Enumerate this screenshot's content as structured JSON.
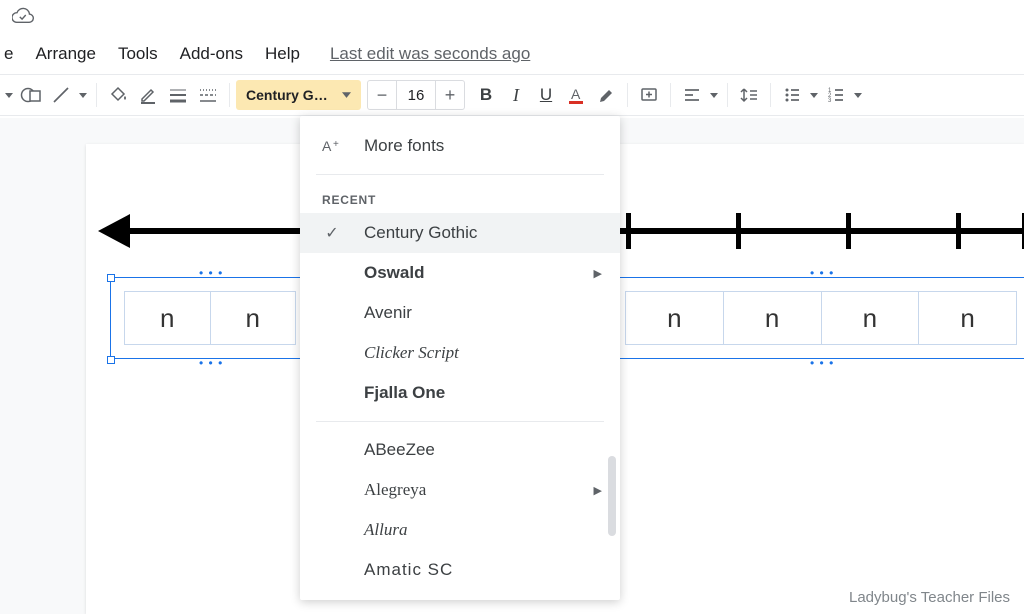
{
  "menubar": {
    "items": [
      "e",
      "Arrange",
      "Tools",
      "Add-ons",
      "Help"
    ],
    "edit_status": "Last edit was seconds ago"
  },
  "toolbar": {
    "font_selector_label": "Century Go…",
    "font_size": "16"
  },
  "font_dropdown": {
    "more_fonts": "More fonts",
    "recent_label": "RECENT",
    "recent": [
      {
        "name": "Century Gothic",
        "family": "'Century Gothic','Segoe UI',sans-serif",
        "checked": true
      },
      {
        "name": "Oswald",
        "family": "'Arial Narrow',sans-serif",
        "weight": "bold",
        "submenu": true
      },
      {
        "name": "Avenir",
        "family": "'Segoe UI',sans-serif"
      },
      {
        "name": "Clicker Script",
        "family": "'Brush Script MT',cursive",
        "style": "italic"
      },
      {
        "name": "Fjalla One",
        "family": "'Arial Narrow',sans-serif",
        "weight": "bold"
      }
    ],
    "all": [
      {
        "name": "ABeeZee",
        "family": "Arial,sans-serif",
        "weight": "500"
      },
      {
        "name": "Alegreya",
        "family": "Georgia,serif",
        "submenu": true
      },
      {
        "name": "Allura",
        "family": "'Brush Script MT',cursive",
        "style": "italic"
      },
      {
        "name": "Amatic SC",
        "family": "'Arial Narrow',sans-serif",
        "spacing": "1px"
      }
    ]
  },
  "canvas": {
    "table_cells": [
      "n",
      "n",
      "n",
      "n",
      "n",
      "n"
    ]
  },
  "watermark": "Ladybug's Teacher Files"
}
